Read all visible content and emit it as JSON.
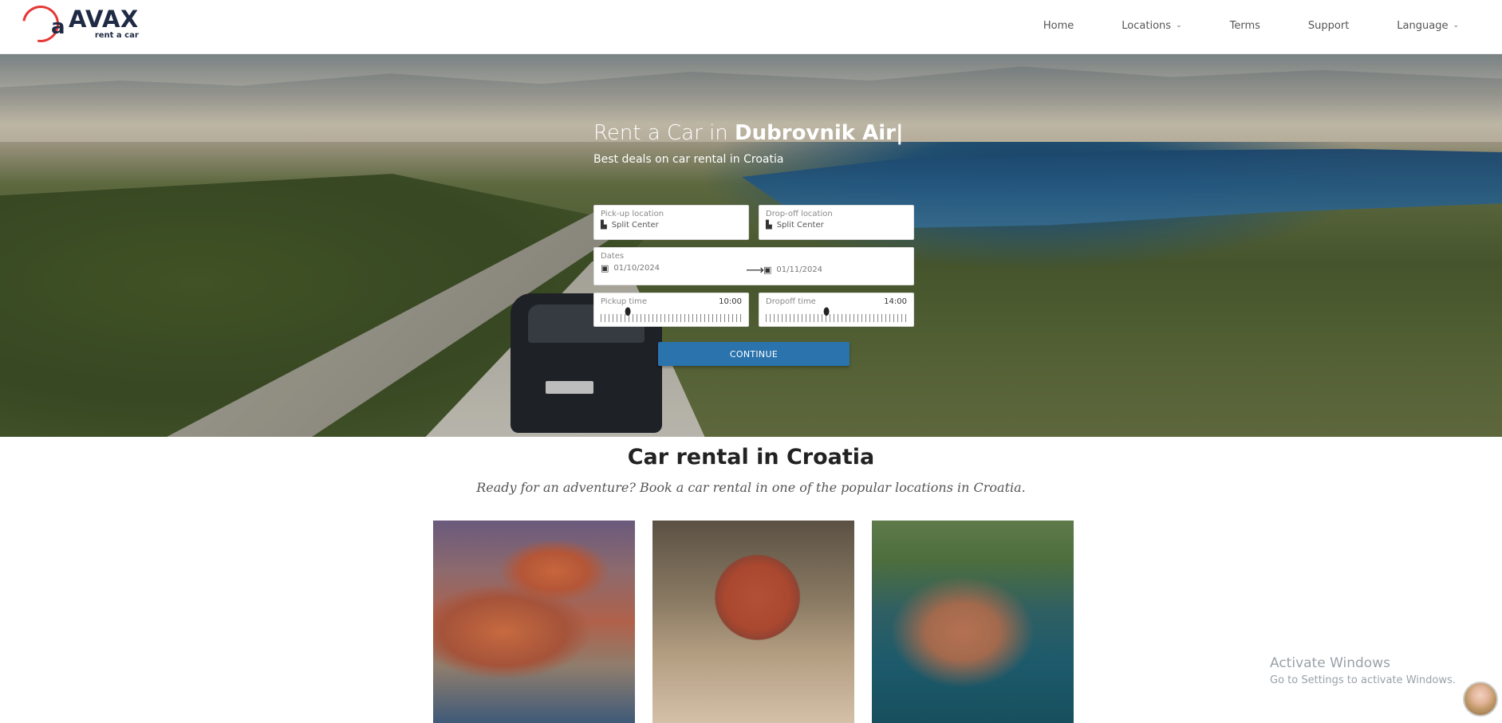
{
  "brand": {
    "logo_letter": "a",
    "name": "AVAX",
    "tagline": "rent a car",
    "accent_color": "#e53935"
  },
  "nav": {
    "items": [
      {
        "label": "Home",
        "dropdown": false
      },
      {
        "label": "Locations",
        "dropdown": true
      },
      {
        "label": "Terms",
        "dropdown": false
      },
      {
        "label": "Support",
        "dropdown": false
      },
      {
        "label": "Language",
        "dropdown": true
      }
    ]
  },
  "hero": {
    "title_prefix": "Rent a Car in ",
    "title_highlight": "Dubrovnik Air|",
    "subtitle": "Best deals on car rental in Croatia"
  },
  "form": {
    "pickup_location": {
      "label": "Pick-up location",
      "value": "Split Center",
      "icon": "building-icon"
    },
    "dropoff_location": {
      "label": "Drop-off location",
      "value": "Split Center",
      "icon": "building-icon"
    },
    "dates": {
      "label": "Dates",
      "start": "01/10/2024",
      "end": "01/11/2024"
    },
    "pickup_time": {
      "label": "Pickup time",
      "value": "10:00"
    },
    "dropoff_time": {
      "label": "Dropoff time",
      "value": "14:00"
    },
    "continue_label": "CONTINUE",
    "button_color": "#2a73ad"
  },
  "section": {
    "title": "Car rental in Croatia",
    "subtitle": "Ready for an adventure? Book a car rental in one of the popular locations in Croatia."
  },
  "watermark": {
    "line1": "Activate Windows",
    "line2": "Go to Settings to activate Windows."
  }
}
